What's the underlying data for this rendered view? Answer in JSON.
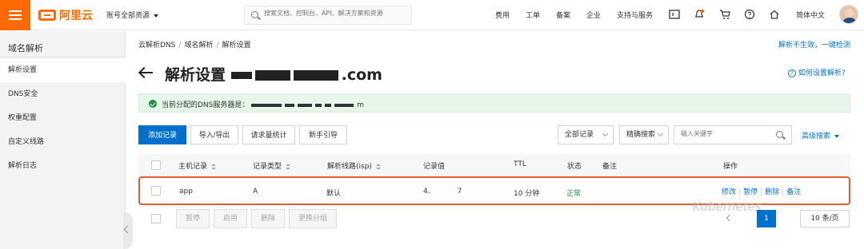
{
  "topbar": {
    "account_label": "账号全部资源",
    "search_placeholder": "搜索文档、控制台、API、解决方案和资源",
    "nav": [
      "费用",
      "工单",
      "备案",
      "企业",
      "支持与服务"
    ],
    "language": "简体中文"
  },
  "sidebar": {
    "title": "域名解析",
    "items": [
      "解析设置",
      "DNS安全",
      "权重配置",
      "自定义线路",
      "解析日志"
    ]
  },
  "breadcrumb": [
    "云解析DNS",
    "域名解析",
    "解析设置"
  ],
  "top_link": "解析不生效，一键检测",
  "title": {
    "prefix": "解析设置",
    "suffix": ".com"
  },
  "help_link": "如何设置解析?",
  "notice": {
    "prefix": "当前分配的DNS服务器是：",
    "suffix": "m"
  },
  "toolbar": {
    "buttons": [
      "添加记录",
      "导入/导出",
      "请求量统计",
      "新手引导"
    ],
    "filter_all": "全部记录",
    "filter_mode": "精确搜索",
    "keyword_placeholder": "输入关键字",
    "advanced": "高级搜索"
  },
  "table": {
    "headers": [
      "主机记录",
      "记录类型",
      "解析线路(isp)",
      "记录值",
      "TTL",
      "状态",
      "备注",
      "操作"
    ],
    "rows": [
      {
        "host": "app",
        "type": "A",
        "line": "默认",
        "value_start": "4.",
        "value_end": "7",
        "ttl": "10 分钟",
        "status": "正常",
        "remark": "",
        "actions": [
          "修改",
          "暂停",
          "删除",
          "备注"
        ]
      }
    ]
  },
  "bulk_actions": [
    "暂停",
    "启用",
    "删除",
    "更换分组"
  ],
  "watermark": "Kubernetes",
  "pager": {
    "current_page": "1",
    "page_size": "10 条/页"
  },
  "colors": {
    "brand": "#ff6a00",
    "primary": "#0070cc",
    "highlight_border": "#e45d2f",
    "success": "#1e8e3e"
  }
}
